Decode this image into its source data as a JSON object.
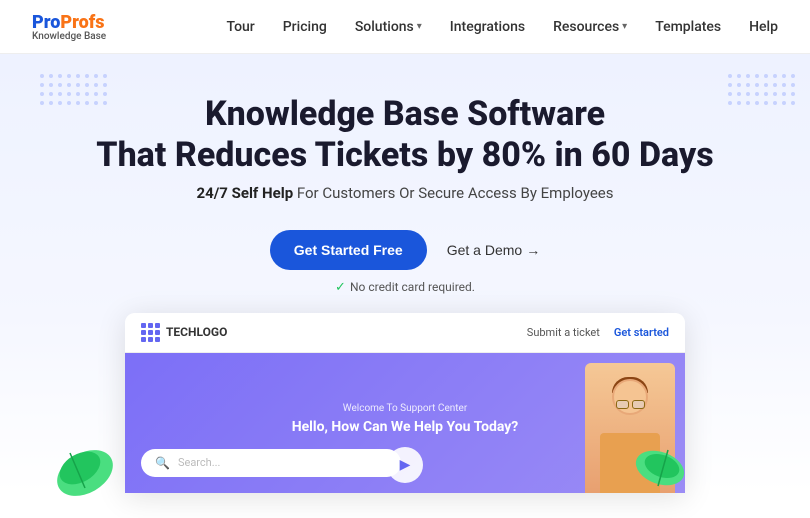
{
  "logo": {
    "pro": "Pro",
    "profs": "Profs",
    "subtitle": "Knowledge Base"
  },
  "navbar": {
    "links": [
      {
        "label": "Tour",
        "has_dropdown": false
      },
      {
        "label": "Pricing",
        "has_dropdown": false
      },
      {
        "label": "Solutions",
        "has_dropdown": true
      },
      {
        "label": "Integrations",
        "has_dropdown": false
      },
      {
        "label": "Resources",
        "has_dropdown": true
      },
      {
        "label": "Templates",
        "has_dropdown": false
      },
      {
        "label": "Help",
        "has_dropdown": false
      }
    ]
  },
  "hero": {
    "headline_line1": "Knowledge Base Software",
    "headline_line2": "That Reduces Tickets by 80% in 60 Days",
    "subtext_bold": "24/7 Self Help",
    "subtext_rest": " For Customers Or Secure Access By Employees",
    "cta_primary": "Get Started Free",
    "cta_demo": "Get a Demo",
    "no_credit": "No credit card required."
  },
  "preview": {
    "logo_text": "TECHLOGO",
    "submit_ticket": "Submit a ticket",
    "get_started": "Get started",
    "welcome": "Welcome To Support Center",
    "headline": "Hello, How Can We Help You Today?",
    "search_placeholder": "Search..."
  }
}
